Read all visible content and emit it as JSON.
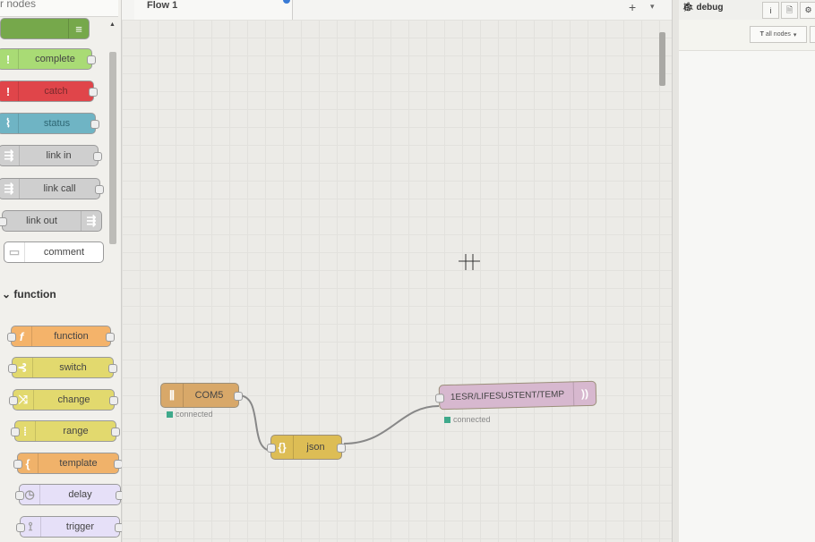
{
  "palette": {
    "filter_placeholder": "ter nodes",
    "common_nodes": [
      {
        "label": "",
        "color": "#76a84b",
        "icon": "list-icon"
      },
      {
        "label": "complete",
        "color": "#a9db75",
        "icon": "exclamation-icon"
      },
      {
        "label": "catch",
        "color": "#e0454a",
        "icon": "exclamation-icon"
      },
      {
        "label": "status",
        "color": "#6fb4c4",
        "icon": "pulse-icon"
      },
      {
        "label": "link in",
        "color": "#cfcfcf",
        "icon": "link-icon"
      },
      {
        "label": "link call",
        "color": "#cfcfcf",
        "icon": "link-icon"
      },
      {
        "label": "link out",
        "color": "#cfcfcf",
        "icon": "link-icon"
      },
      {
        "label": "comment",
        "color": "#ffffff",
        "icon": "comment-icon"
      }
    ],
    "function_category": "function",
    "function_nodes": [
      {
        "label": "function",
        "color": "#f4b36a",
        "icon": "function-icon"
      },
      {
        "label": "switch",
        "color": "#e2d96e",
        "icon": "switch-icon"
      },
      {
        "label": "change",
        "color": "#e2d96e",
        "icon": "shuffle-icon"
      },
      {
        "label": "range",
        "color": "#e2d96e",
        "icon": "range-icon"
      },
      {
        "label": "template",
        "color": "#f0b26a",
        "icon": "template-icon"
      },
      {
        "label": "delay",
        "color": "#e6e0f8",
        "icon": "clock-icon"
      },
      {
        "label": "trigger",
        "color": "#e6e0f8",
        "icon": "trigger-icon"
      }
    ]
  },
  "tabs": {
    "flow_label": "Flow 1",
    "add": "+",
    "menu": "▾"
  },
  "flow": {
    "serial_node": {
      "label": "COM5",
      "status": "connected",
      "color": "#d8a869"
    },
    "json_node": {
      "label": "json",
      "color": "#ddbd55"
    },
    "mqtt_node": {
      "label": "1ESR/LIFESUSTENT/TEMP",
      "status": "connected",
      "color": "#d7b8cf"
    }
  },
  "sidebar": {
    "tab_label": "debug",
    "buttons": [
      "i",
      "🗎",
      "⚙"
    ],
    "filter_label": "all nodes"
  }
}
